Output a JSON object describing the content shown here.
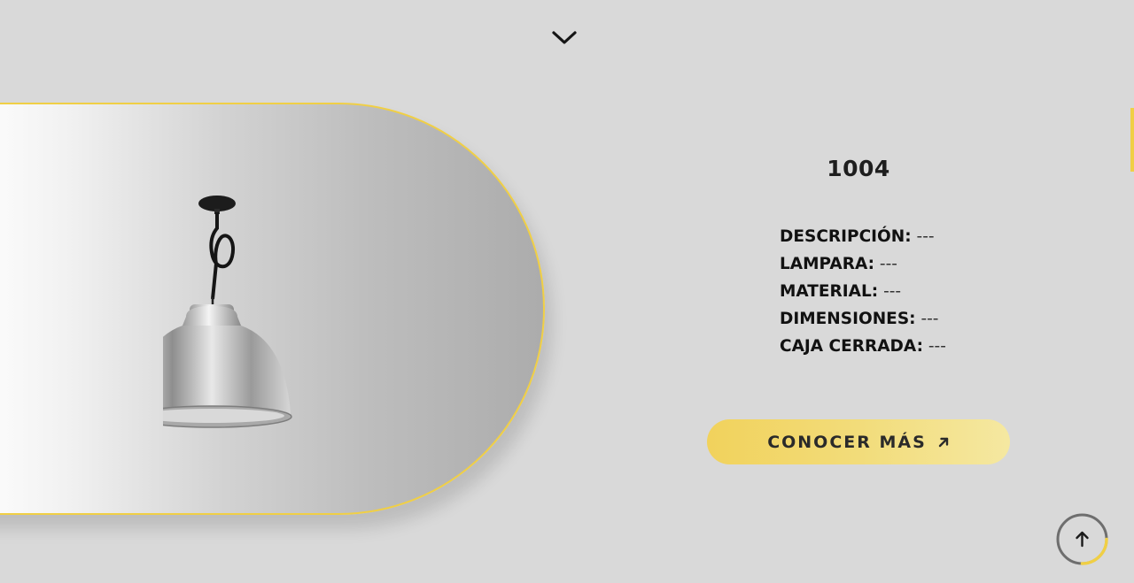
{
  "product": {
    "title": "1004",
    "image_alt": "Lámpara colgante de aluminio"
  },
  "specs": [
    {
      "label": "DESCRIPCIÓN:",
      "value": "---"
    },
    {
      "label": "LAMPARA:",
      "value": "---"
    },
    {
      "label": "MATERIAL:",
      "value": "---"
    },
    {
      "label": "DIMENSIONES:",
      "value": "---"
    },
    {
      "label": "CAJA CERRADA:",
      "value": "---"
    }
  ],
  "cta": {
    "label": "CONOCER MÁS",
    "icon": "arrow-up-right-icon"
  },
  "icons": {
    "scroll_down": "chevron-down-icon",
    "back_to_top": "arrow-up-icon"
  },
  "scroll_progress": 0.25,
  "colors": {
    "background": "#d9d9d9",
    "accent": "#f0cf45",
    "text": "#1a1a1a"
  }
}
